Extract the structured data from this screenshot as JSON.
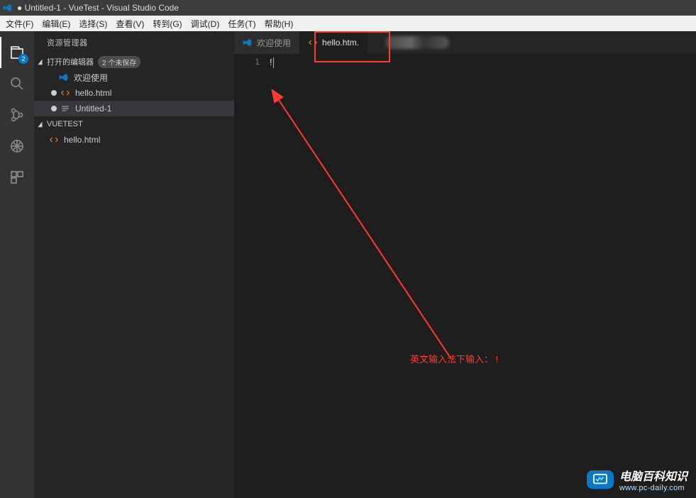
{
  "title": "● Untitled-1 - VueTest - Visual Studio Code",
  "menu": [
    "文件(F)",
    "编辑(E)",
    "选择(S)",
    "查看(V)",
    "转到(G)",
    "调试(D)",
    "任务(T)",
    "帮助(H)"
  ],
  "activity_badge": "2",
  "sidebar": {
    "title": "资源管理器",
    "open_editors": {
      "label": "打开的编辑器",
      "badge": "2 个未保存"
    },
    "items": [
      {
        "label": "欢迎使用",
        "type": "welcome"
      },
      {
        "label": "hello.html",
        "type": "html",
        "unsaved": true
      },
      {
        "label": "Untitled-1",
        "type": "untitled",
        "unsaved": true,
        "selected": true
      }
    ],
    "project": "VUETEST",
    "files": [
      {
        "label": "hello.html",
        "type": "html"
      }
    ]
  },
  "tabs": [
    {
      "label": "欢迎使用",
      "type": "welcome"
    },
    {
      "label": "hello.htm.",
      "type": "html",
      "active": true,
      "highlighted": true
    }
  ],
  "editor": {
    "line_number": "1",
    "content": "!"
  },
  "annotation": "英文输入法下输入：  !",
  "watermark": {
    "cn": "电脑百科知识",
    "url": "www.pc-daily.com"
  }
}
